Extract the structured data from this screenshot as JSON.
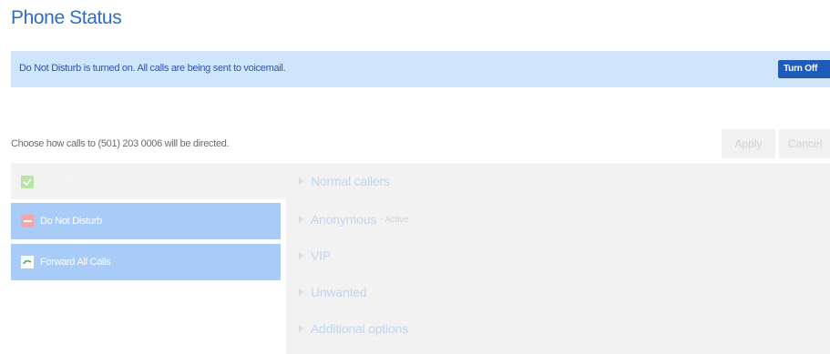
{
  "page_title": "Phone Status",
  "banner": {
    "message": "Do Not Disturb is turned on. All calls are being sent to voicemail.",
    "turn_off_label": "Turn Off"
  },
  "directions": "Choose how calls to (501) 203 0006 will be directed.",
  "actions": {
    "apply_label": "Apply",
    "cancel_label": "Cancel"
  },
  "status_options": [
    {
      "label": "Available",
      "icon": "check-icon",
      "selected": false
    },
    {
      "label": "Do Not Disturb",
      "icon": "do-not-disturb-icon",
      "selected": true
    },
    {
      "label": "Forward All Calls",
      "icon": "forward-calls-icon",
      "selected": true
    }
  ],
  "caller_rules": [
    {
      "label": "Normal callers",
      "status": ""
    },
    {
      "label": "Anonymous",
      "status": "- Active"
    },
    {
      "label": "VIP",
      "status": ""
    },
    {
      "label": "Unwanted",
      "status": ""
    },
    {
      "label": "Additional options",
      "status": ""
    }
  ],
  "colors": {
    "accent": "#2e6dc4",
    "banner_bg": "#cfe5fb",
    "turn_off_bg": "#1f5bb8",
    "selected_option_bg": "#a8cbf7",
    "panel_bg": "#f2f2f2"
  }
}
